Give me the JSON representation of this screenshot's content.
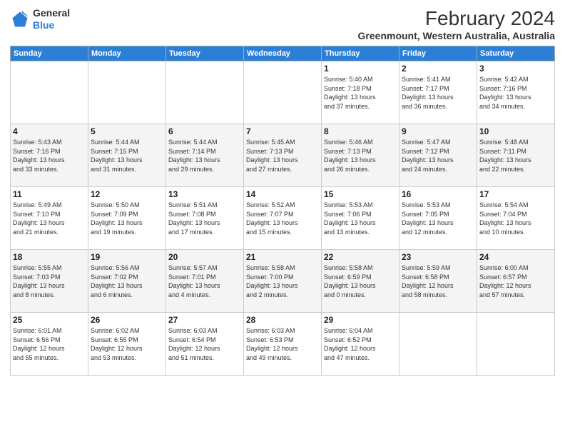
{
  "logo": {
    "line1": "General",
    "line2": "Blue"
  },
  "title": "February 2024",
  "subtitle": "Greenmount, Western Australia, Australia",
  "headers": [
    "Sunday",
    "Monday",
    "Tuesday",
    "Wednesday",
    "Thursday",
    "Friday",
    "Saturday"
  ],
  "weeks": [
    [
      {
        "day": "",
        "info": ""
      },
      {
        "day": "",
        "info": ""
      },
      {
        "day": "",
        "info": ""
      },
      {
        "day": "",
        "info": ""
      },
      {
        "day": "1",
        "info": "Sunrise: 5:40 AM\nSunset: 7:18 PM\nDaylight: 13 hours\nand 37 minutes."
      },
      {
        "day": "2",
        "info": "Sunrise: 5:41 AM\nSunset: 7:17 PM\nDaylight: 13 hours\nand 36 minutes."
      },
      {
        "day": "3",
        "info": "Sunrise: 5:42 AM\nSunset: 7:16 PM\nDaylight: 13 hours\nand 34 minutes."
      }
    ],
    [
      {
        "day": "4",
        "info": "Sunrise: 5:43 AM\nSunset: 7:16 PM\nDaylight: 13 hours\nand 33 minutes."
      },
      {
        "day": "5",
        "info": "Sunrise: 5:44 AM\nSunset: 7:15 PM\nDaylight: 13 hours\nand 31 minutes."
      },
      {
        "day": "6",
        "info": "Sunrise: 5:44 AM\nSunset: 7:14 PM\nDaylight: 13 hours\nand 29 minutes."
      },
      {
        "day": "7",
        "info": "Sunrise: 5:45 AM\nSunset: 7:13 PM\nDaylight: 13 hours\nand 27 minutes."
      },
      {
        "day": "8",
        "info": "Sunrise: 5:46 AM\nSunset: 7:13 PM\nDaylight: 13 hours\nand 26 minutes."
      },
      {
        "day": "9",
        "info": "Sunrise: 5:47 AM\nSunset: 7:12 PM\nDaylight: 13 hours\nand 24 minutes."
      },
      {
        "day": "10",
        "info": "Sunrise: 5:48 AM\nSunset: 7:11 PM\nDaylight: 13 hours\nand 22 minutes."
      }
    ],
    [
      {
        "day": "11",
        "info": "Sunrise: 5:49 AM\nSunset: 7:10 PM\nDaylight: 13 hours\nand 21 minutes."
      },
      {
        "day": "12",
        "info": "Sunrise: 5:50 AM\nSunset: 7:09 PM\nDaylight: 13 hours\nand 19 minutes."
      },
      {
        "day": "13",
        "info": "Sunrise: 5:51 AM\nSunset: 7:08 PM\nDaylight: 13 hours\nand 17 minutes."
      },
      {
        "day": "14",
        "info": "Sunrise: 5:52 AM\nSunset: 7:07 PM\nDaylight: 13 hours\nand 15 minutes."
      },
      {
        "day": "15",
        "info": "Sunrise: 5:53 AM\nSunset: 7:06 PM\nDaylight: 13 hours\nand 13 minutes."
      },
      {
        "day": "16",
        "info": "Sunrise: 5:53 AM\nSunset: 7:05 PM\nDaylight: 13 hours\nand 12 minutes."
      },
      {
        "day": "17",
        "info": "Sunrise: 5:54 AM\nSunset: 7:04 PM\nDaylight: 13 hours\nand 10 minutes."
      }
    ],
    [
      {
        "day": "18",
        "info": "Sunrise: 5:55 AM\nSunset: 7:03 PM\nDaylight: 13 hours\nand 8 minutes."
      },
      {
        "day": "19",
        "info": "Sunrise: 5:56 AM\nSunset: 7:02 PM\nDaylight: 13 hours\nand 6 minutes."
      },
      {
        "day": "20",
        "info": "Sunrise: 5:57 AM\nSunset: 7:01 PM\nDaylight: 13 hours\nand 4 minutes."
      },
      {
        "day": "21",
        "info": "Sunrise: 5:58 AM\nSunset: 7:00 PM\nDaylight: 13 hours\nand 2 minutes."
      },
      {
        "day": "22",
        "info": "Sunrise: 5:58 AM\nSunset: 6:59 PM\nDaylight: 13 hours\nand 0 minutes."
      },
      {
        "day": "23",
        "info": "Sunrise: 5:59 AM\nSunset: 6:58 PM\nDaylight: 12 hours\nand 58 minutes."
      },
      {
        "day": "24",
        "info": "Sunrise: 6:00 AM\nSunset: 6:57 PM\nDaylight: 12 hours\nand 57 minutes."
      }
    ],
    [
      {
        "day": "25",
        "info": "Sunrise: 6:01 AM\nSunset: 6:56 PM\nDaylight: 12 hours\nand 55 minutes."
      },
      {
        "day": "26",
        "info": "Sunrise: 6:02 AM\nSunset: 6:55 PM\nDaylight: 12 hours\nand 53 minutes."
      },
      {
        "day": "27",
        "info": "Sunrise: 6:03 AM\nSunset: 6:54 PM\nDaylight: 12 hours\nand 51 minutes."
      },
      {
        "day": "28",
        "info": "Sunrise: 6:03 AM\nSunset: 6:53 PM\nDaylight: 12 hours\nand 49 minutes."
      },
      {
        "day": "29",
        "info": "Sunrise: 6:04 AM\nSunset: 6:52 PM\nDaylight: 12 hours\nand 47 minutes."
      },
      {
        "day": "",
        "info": ""
      },
      {
        "day": "",
        "info": ""
      }
    ]
  ]
}
